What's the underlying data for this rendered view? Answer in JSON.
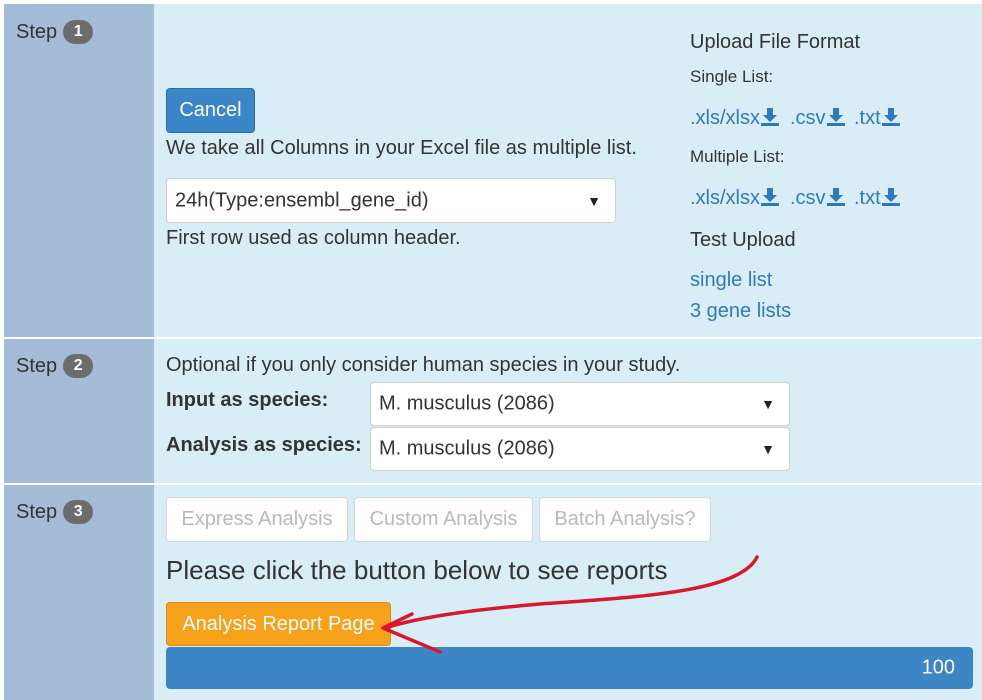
{
  "step1": {
    "step_label": "Step",
    "badge": "1",
    "cancel_label": "Cancel",
    "info_text": "We take all Columns in your Excel file as multiple list.",
    "column_select": {
      "value": "24h(Type:ensembl_gene_id)"
    },
    "header_note": "First row used as column header.",
    "upload_format": {
      "heading": "Upload File Format",
      "single_label": "Single List:",
      "multiple_label": "Multiple List:",
      "links": [
        ".xls/xlsx",
        ".csv",
        ".txt"
      ],
      "test_heading": "Test Upload",
      "test_links": [
        "single list",
        "3 gene lists"
      ]
    }
  },
  "step2": {
    "step_label": "Step",
    "badge": "2",
    "optional_text": "Optional if you only consider human species in your study.",
    "input_species_label": "Input as species:",
    "input_species_value": "M. musculus (2086)",
    "analysis_species_label": "Analysis as species:",
    "analysis_species_value": "M. musculus (2086)"
  },
  "step3": {
    "step_label": "Step",
    "badge": "3",
    "buttons": [
      "Express Analysis",
      "Custom Analysis",
      "Batch Analysis?"
    ],
    "prompt": "Please click the button below to see reports",
    "report_button": "Analysis Report Page",
    "progress_value": 100,
    "progress_label": "100"
  },
  "colors": {
    "primary": "#3b86c8",
    "orange": "#f7a21a",
    "annotation_arrow": "#d9182d",
    "panel_bg": "#d9edf7",
    "step_bg": "#a5bcd8"
  }
}
